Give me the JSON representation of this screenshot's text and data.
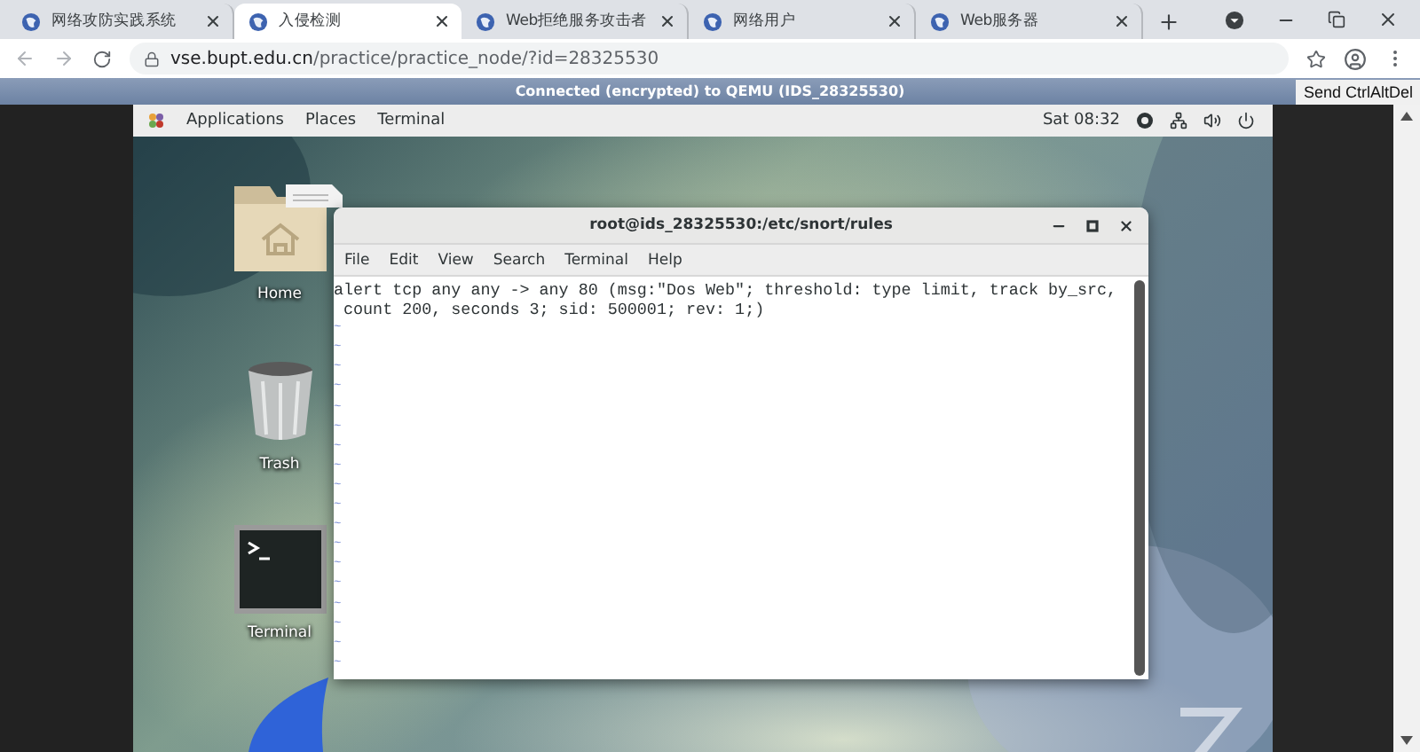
{
  "browser": {
    "tabs": [
      {
        "label": "网络攻防实践系统",
        "selected": false
      },
      {
        "label": "入侵检测",
        "selected": true
      },
      {
        "label": "Web拒绝服务攻击者",
        "selected": false
      },
      {
        "label": "网络用户",
        "selected": false
      },
      {
        "label": "Web服务器",
        "selected": false
      }
    ],
    "address_bar": {
      "host": "vse.bupt.edu.cn",
      "path": "/practice/practice_node/?id=28325530"
    }
  },
  "vnc": {
    "status": "Connected (encrypted) to QEMU (IDS_28325530)",
    "send_button": "Send CtrlAltDel"
  },
  "top_bar": {
    "menus": [
      "Applications",
      "Places",
      "Terminal"
    ],
    "clock": "Sat 08:32"
  },
  "desktop_icons": [
    {
      "label": "Home",
      "kind": "folder"
    },
    {
      "kind": "document"
    },
    {
      "label": "Trash",
      "kind": "trash"
    },
    {
      "label": "Terminal",
      "kind": "terminal"
    }
  ],
  "terminal_window": {
    "title": "root@ids_28325530:/etc/snort/rules",
    "menu": [
      "File",
      "Edit",
      "View",
      "Search",
      "Terminal",
      "Help"
    ],
    "lines": [
      {
        "text": "alert tcp any any -> any 80 (msg:\"Dos Web\"; threshold: type limit, track by_src,",
        "kind": "text"
      },
      {
        "text": " count 200, seconds 3; sid: 500001; rev: 1;)",
        "kind": "text"
      },
      {
        "text": "~",
        "kind": "filler"
      },
      {
        "text": "~",
        "kind": "filler"
      },
      {
        "text": "~",
        "kind": "filler"
      },
      {
        "text": "~",
        "kind": "filler"
      },
      {
        "text": "~",
        "kind": "filler"
      },
      {
        "text": "~",
        "kind": "filler"
      },
      {
        "text": "~",
        "kind": "filler"
      },
      {
        "text": "~",
        "kind": "filler"
      },
      {
        "text": "~",
        "kind": "filler"
      },
      {
        "text": "~",
        "kind": "filler"
      },
      {
        "text": "~",
        "kind": "filler"
      },
      {
        "text": "~",
        "kind": "filler"
      },
      {
        "text": "~",
        "kind": "filler"
      },
      {
        "text": "~",
        "kind": "filler"
      },
      {
        "text": "~",
        "kind": "filler"
      },
      {
        "text": "~",
        "kind": "filler"
      },
      {
        "text": "~",
        "kind": "filler"
      },
      {
        "text": "~",
        "kind": "filler"
      }
    ]
  }
}
